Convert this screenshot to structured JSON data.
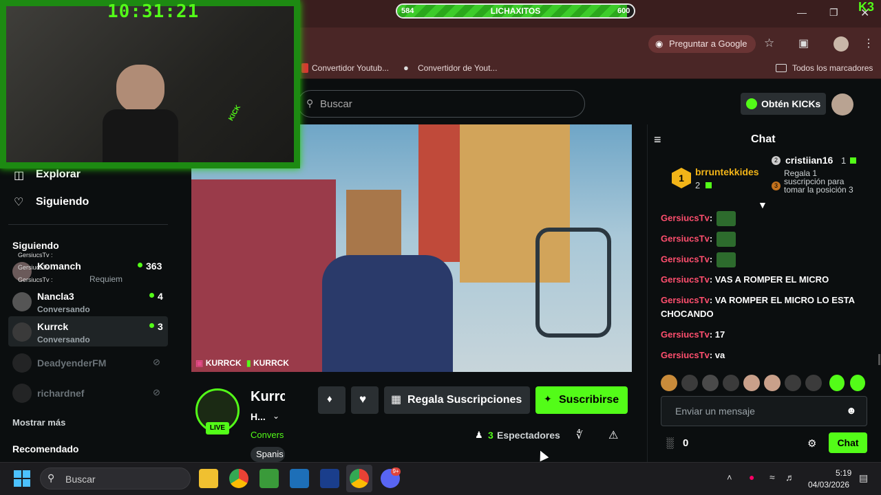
{
  "overlay": {
    "clock": "10:31:21",
    "progress_left": "584",
    "progress_title": "LICHAXITOS",
    "progress_right": "600",
    "progress_fraction": 0.97,
    "webcam_brand": "KICK"
  },
  "browser": {
    "ask_google": "Preguntar a Google",
    "bookmarks": [
      "Convertidor Youtub...",
      "Convertidor de Yout..."
    ],
    "all_bookmarks": "Todos los marcadores"
  },
  "kick": {
    "search_placeholder": "Buscar",
    "get_kicks": "Obtén KICKs",
    "nav": {
      "explore": "Explorar",
      "following": "Siguiendo"
    },
    "following_header": "Siguiendo",
    "channels": [
      {
        "name": "Komanch",
        "sub": "Requiem",
        "viewers": "363",
        "live": true
      },
      {
        "name": "Nancla3",
        "sub": "Conversando",
        "viewers": "4",
        "live": true
      },
      {
        "name": "Kurrck",
        "sub": "Conversando",
        "viewers": "3",
        "live": true
      },
      {
        "name": "DeadyenderFM",
        "sub": "",
        "viewers": "",
        "live": false
      },
      {
        "name": "richardnef",
        "sub": "",
        "viewers": "",
        "live": false
      }
    ],
    "overlay_chat": [
      "GersiucsTv :",
      "GersiucsTv :",
      "GersiucsTv :"
    ],
    "show_more": "Mostrar más",
    "recommended": "Recomendado",
    "stream": {
      "watermark_1": "KURRCK",
      "watermark_2": "KURRCK",
      "channel_name": "Kurrc",
      "title": "H...",
      "category": "Convers",
      "tag": "Spanis",
      "live_badge": "LIVE",
      "gift_subs": "Regala Suscripciones",
      "subscribe": "Suscribirse",
      "viewer_count": "3",
      "viewers_label": "Espectadores"
    },
    "chat": {
      "title": "Chat",
      "leader_rank": "1",
      "leader_name": "brruntekkides",
      "leader_count": "2",
      "second_rank": "2",
      "second_name": "cristiian16",
      "second_count": "1",
      "third_rank": "3",
      "third_text": "Regala 1 suscripción para tomar la posición 3",
      "messages": [
        {
          "user": "GersiucsTv",
          "text": "",
          "emote": true
        },
        {
          "user": "GersiucsTv",
          "text": "",
          "emote": true
        },
        {
          "user": "GersiucsTv",
          "text": "",
          "emote": true
        },
        {
          "user": "GersiucsTv",
          "text": "VAS A ROMPER EL MICRO",
          "emote": false
        },
        {
          "user": "GersiucsTv",
          "text": "VA ROMPER EL MICRO LO ESTA CHOCANDO",
          "emote": false
        },
        {
          "user": "GersiucsTv",
          "text": "17",
          "emote": false
        },
        {
          "user": "GersiucsTv",
          "text": "va",
          "emote": false
        }
      ],
      "input_placeholder": "Enviar un mensaje",
      "kicks_balance": "0",
      "send": "Chat"
    }
  },
  "taskbar": {
    "search": "Buscar",
    "time": "5:19",
    "date": "04/03/2026",
    "discord_badge": "9+"
  }
}
